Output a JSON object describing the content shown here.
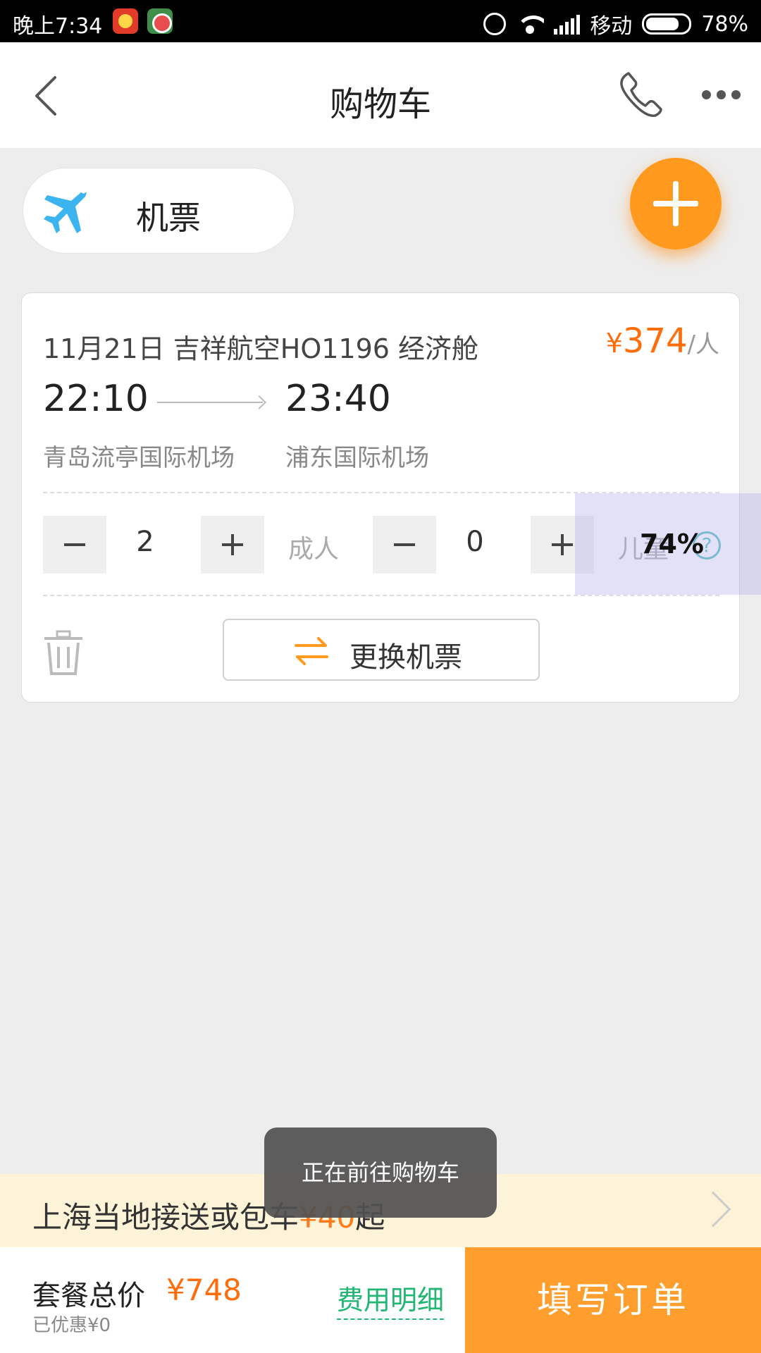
{
  "status_bar": {
    "time": "晚上7:34",
    "carrier": "移动",
    "battery": "78%",
    "battery_level": 0.78
  },
  "header": {
    "title": "购物车",
    "icons": [
      "back-icon",
      "phone-icon",
      "more-icon"
    ]
  },
  "category": {
    "label": "机票",
    "icon": "plane-icon"
  },
  "flight": {
    "info": "11月21日 吉祥航空HO1196 经济舱",
    "price_symbol": "¥",
    "price_value": "374",
    "price_unit": "/人",
    "dep_time": "22:10",
    "arr_time": "23:40",
    "dep_airport": "青岛流亭国际机场",
    "arr_airport": "浦东国际机场",
    "adult_count": "2",
    "adult_label": "成人",
    "child_count": "0",
    "child_label": "儿童",
    "change_label": "更换机票"
  },
  "overlay": {
    "text": "74%"
  },
  "toast": {
    "text": "正在前往购物车"
  },
  "banner": {
    "prefix": "上海当地接送或包车",
    "price": "¥40",
    "suffix": "起"
  },
  "bottom": {
    "total_label": "套餐总价",
    "total_price": "¥748",
    "discount": "已优惠¥0",
    "fee_detail": "费用明细",
    "submit": "填写订单"
  },
  "colors": {
    "accent": "#ff9e2d",
    "price": "#ff6d0b",
    "plane": "#3cb4ef",
    "green": "#22b573"
  }
}
